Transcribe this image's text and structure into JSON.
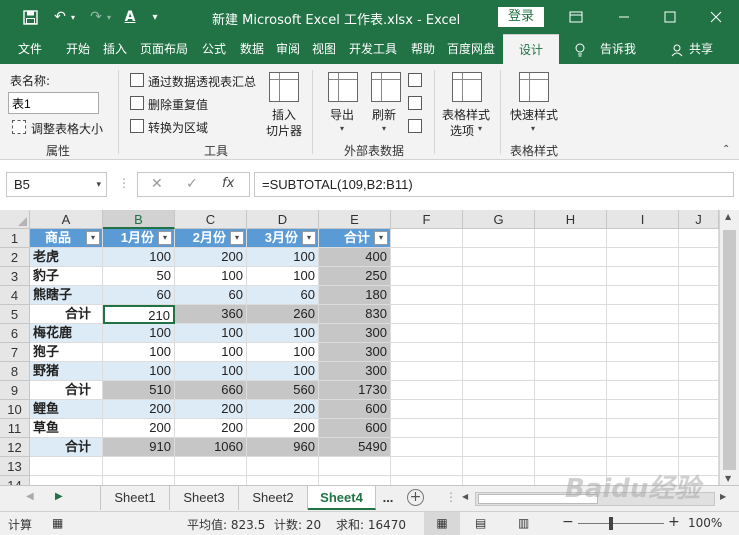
{
  "title_bar": {
    "title": "新建 Microsoft Excel 工作表.xlsx  -  Excel",
    "login_label": "登录",
    "icons": [
      "save-icon",
      "undo-icon",
      "redo-icon",
      "font-color-icon",
      "customize-icon",
      "ribbon-display-icon",
      "minimize-icon",
      "maximize-icon",
      "close-icon"
    ]
  },
  "ribbon_tabs": [
    "文件",
    "开始",
    "插入",
    "页面布局",
    "公式",
    "数据",
    "审阅",
    "视图",
    "开发工具",
    "帮助",
    "百度网盘",
    "设计",
    "告诉我",
    "共享"
  ],
  "active_tab": "设计",
  "ribbon": {
    "properties": {
      "table_name_label": "表名称:",
      "table_name_value": "表1",
      "resize_label": "调整表格大小",
      "group_label": "属性"
    },
    "tools": {
      "pivot_label": "通过数据透视表汇总",
      "remove_dup_label": "删除重复值",
      "convert_label": "转换为区域",
      "slicer_label_1": "插入",
      "slicer_label_2": "切片器",
      "group_label": "工具"
    },
    "external": {
      "export_label": "导出",
      "refresh_label": "刷新",
      "group_label": "外部表数据"
    },
    "style_options": {
      "label_1": "表格样式",
      "label_2": "选项"
    },
    "styles": {
      "quick_label": "快速样式",
      "group_label": "表格样式"
    }
  },
  "formula_bar": {
    "name_box": "B5",
    "fx": "fx",
    "formula": "=SUBTOTAL(109,B2:B11)"
  },
  "grid": {
    "columns": [
      "A",
      "B",
      "C",
      "D",
      "E",
      "F",
      "G",
      "H",
      "I",
      "J"
    ],
    "rows": [
      "1",
      "2",
      "3",
      "4",
      "5",
      "6",
      "7",
      "8",
      "9",
      "10",
      "11",
      "12",
      "13",
      "14"
    ],
    "header": [
      "商品",
      "1月份",
      "2月份",
      "3月份",
      "合计"
    ],
    "data": [
      [
        "老虎",
        "100",
        "200",
        "100",
        "400"
      ],
      [
        "豹子",
        "50",
        "100",
        "100",
        "250"
      ],
      [
        "熊瞎子",
        "60",
        "60",
        "60",
        "180"
      ],
      [
        "合计",
        "210",
        "360",
        "260",
        "830"
      ],
      [
        "梅花鹿",
        "100",
        "100",
        "100",
        "300"
      ],
      [
        "狍子",
        "100",
        "100",
        "100",
        "300"
      ],
      [
        "野猪",
        "100",
        "100",
        "100",
        "300"
      ],
      [
        "合计",
        "510",
        "660",
        "560",
        "1730"
      ],
      [
        "鲤鱼",
        "200",
        "200",
        "200",
        "600"
      ],
      [
        "草鱼",
        "200",
        "200",
        "200",
        "600"
      ],
      [
        "合计",
        "910",
        "1060",
        "960",
        "5490"
      ]
    ],
    "active_cell": "B5"
  },
  "sheet_tabs": [
    "Sheet1",
    "Sheet3",
    "Sheet2",
    "Sheet4"
  ],
  "active_sheet": "Sheet4",
  "sheet_more": "...",
  "status_bar": {
    "mode": "计算",
    "average": "平均值: 823.5",
    "count": "计数: 20",
    "sum": "求和: 16470",
    "zoom": "100%",
    "minus": "−",
    "plus": "+"
  },
  "watermark": "Baidu经验",
  "colors": {
    "excel_green": "#217346",
    "table_header": "#5b9bd5",
    "band": "#ddebf7",
    "subtotal": "#c6c6c6"
  }
}
